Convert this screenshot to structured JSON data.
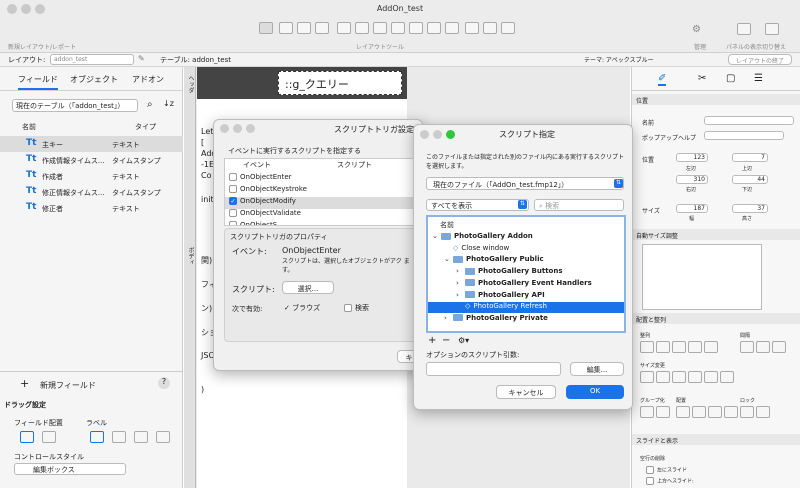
{
  "window": {
    "title": "AddOn_test"
  },
  "toolbar": {
    "new_layout": "新規レイアウト/レポート",
    "layout_tools": "レイアウトツール",
    "manage": "管理",
    "panel_toggle": "パネルの表示切り替え"
  },
  "layout_bar": {
    "layout_label": "レイアウト:",
    "layout_value": "addon_test",
    "table_label": "テーブル: addon_test",
    "theme_label": "テーマ: アペックスブルー",
    "exit_button": "レイアウトの終了"
  },
  "left_panel": {
    "tabs": [
      "フィールド",
      "オブジェクト",
      "アドオン"
    ],
    "table_select": "現在のテーブル（「addon_test」）",
    "col_name": "名前",
    "col_type": "タイプ",
    "fields": [
      {
        "name": "主キー",
        "type": "テキスト"
      },
      {
        "name": "作成情報タイムス...",
        "type": "タイムスタンプ"
      },
      {
        "name": "作成者",
        "type": "テキスト"
      },
      {
        "name": "修正情報タイムス...",
        "type": "タイムスタンプ"
      },
      {
        "name": "修正者",
        "type": "テキスト"
      }
    ],
    "new_field": "新規フィールド",
    "help": "?",
    "drag_settings": "ドラッグ設定",
    "field_placement": "フィールド配置",
    "label": "ラベル",
    "control_style": "コントロールスタイル",
    "control_value": "編集ボックス"
  },
  "canvas": {
    "header_tag": "ヘッダ",
    "body_tag": "ボディ",
    "query_text": "::g_クエリー",
    "code_lines": [
      "Let",
      "[",
      "Add",
      "-1E",
      "Co",
      "init",
      "関)",
      "フィ",
      "ン)",
      "ショ",
      "JSO",
      ")"
    ]
  },
  "trigger_dialog": {
    "title": "スクリプトトリガ設定",
    "prompt": "イベントに実行するスクリプトを指定する",
    "col_event": "イベント",
    "col_script": "スクリプト",
    "events": [
      {
        "name": "OnObjectEnter",
        "checked": false,
        "selected": false
      },
      {
        "name": "OnObjectKeystroke",
        "checked": false,
        "selected": false
      },
      {
        "name": "OnObjectModify",
        "checked": true,
        "selected": true
      },
      {
        "name": "OnObjectValidate",
        "checked": false,
        "selected": false
      },
      {
        "name": "OnObjectS...",
        "checked": false,
        "selected": false
      }
    ],
    "props_title": "スクリプトトリガのプロパティ",
    "event_label": "イベント:",
    "event_value": "OnObjectEnter",
    "event_desc": "スクリプトは、選択したオブジェクトがアク ます。",
    "script_label": "スクリプト:",
    "select_button": "選択...",
    "enabled_label": "次で有効:",
    "browse": "ブラウズ",
    "find": "検索",
    "cancel_partial": "キ"
  },
  "script_dialog": {
    "title": "スクリプト指定",
    "desc": "このファイルまたは指定された別のファイル内にある実行するスクリプトを選択します。",
    "file_select": "現在のファイル（「AddOn_test.fmp12」）",
    "filter": "すべてを表示",
    "search_placeholder": "検索",
    "list_header": "名前",
    "tree": [
      {
        "label": "PhotoGallery Addon",
        "kind": "folder",
        "depth": 0,
        "open": true,
        "bold": true
      },
      {
        "label": "Close window",
        "kind": "script",
        "depth": 1,
        "open": false,
        "bold": false
      },
      {
        "label": "PhotoGallery Public",
        "kind": "folder",
        "depth": 1,
        "open": true,
        "bold": true
      },
      {
        "label": "PhotoGallery Buttons",
        "kind": "folder",
        "depth": 2,
        "open": false,
        "bold": true
      },
      {
        "label": "PhotoGallery Event Handlers",
        "kind": "folder",
        "depth": 2,
        "open": false,
        "bold": true
      },
      {
        "label": "PhotoGallery API",
        "kind": "folder",
        "depth": 2,
        "open": false,
        "bold": true
      },
      {
        "label": "PhotoGallery Refresh",
        "kind": "script",
        "depth": 2,
        "open": false,
        "bold": false,
        "selected": true
      },
      {
        "label": "PhotoGallery Private",
        "kind": "folder",
        "depth": 1,
        "open": false,
        "bold": true
      }
    ],
    "param_label": "オプションのスクリプト引数:",
    "edit_button": "編集...",
    "cancel_button": "キャンセル",
    "ok_button": "OK"
  },
  "inspector": {
    "position": "位置",
    "name": "名前",
    "popover_help": "ポップアップヘルプ",
    "pos_label": "位置",
    "top": "123",
    "left": "7",
    "right_v": "310",
    "bottom_v": "44",
    "unit": "pt",
    "left_lbl": "左辺",
    "top_lbl": "上辺",
    "right_lbl": "右辺",
    "bottom_lbl": "下辺",
    "size": "サイズ",
    "width": "187",
    "height": "37",
    "w_lbl": "幅",
    "h_lbl": "高さ",
    "autosize": "自動サイズ調整",
    "arrange": "配置と整列",
    "align": "整列",
    "distribute": "間隔",
    "resize": "サイズ変更",
    "group": "グループ化",
    "arrange2": "配置",
    "lock": "ロック",
    "slide": "スライドと表示",
    "blank": "空行の削除",
    "slide_left": "左にスライド",
    "slide_up": "上方へスライド:"
  }
}
